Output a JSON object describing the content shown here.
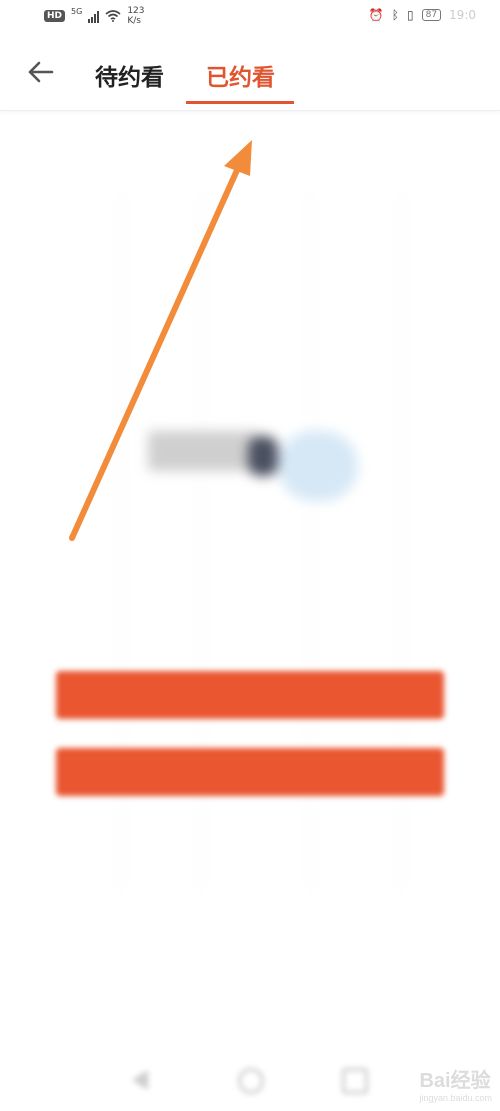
{
  "status_bar": {
    "hd_badge": "HD",
    "network_type": "5G",
    "speed_value": "123",
    "speed_unit": "K/s",
    "battery_level": "87",
    "time": "19:0"
  },
  "top_nav": {
    "tabs": [
      {
        "label": "待约看",
        "active": false
      },
      {
        "label": "已约看",
        "active": true
      }
    ]
  },
  "empty_state": {
    "title": "",
    "subtitle_lines": [
      "",
      ""
    ],
    "primary_button_label": "",
    "secondary_button_label": ""
  },
  "watermark": {
    "brand": "Bai经验",
    "url": "jingyan.baidu.com"
  },
  "colors": {
    "accent": "#e0552f",
    "button": "#e95630",
    "annotation_arrow": "#f28c3a"
  },
  "icons": {
    "back": "arrow-left-icon",
    "wifi": "wifi-icon",
    "signal": "signal-icon",
    "alarm": "alarm-icon",
    "bluetooth": "bluetooth-icon",
    "vibrate": "vibrate-icon",
    "battery": "battery-icon"
  }
}
